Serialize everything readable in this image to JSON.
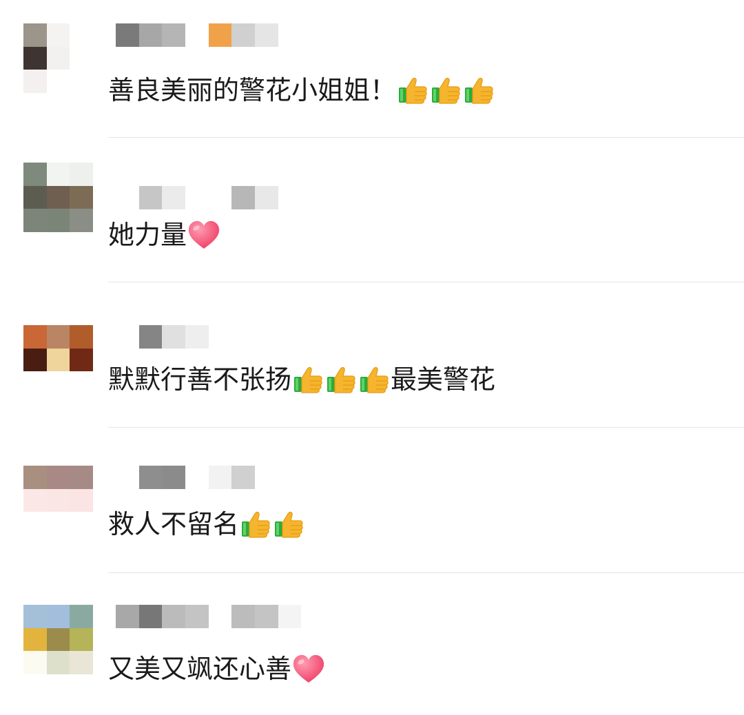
{
  "comments": [
    {
      "text_before": "善良美丽的警花小姐姐！",
      "thumbs": 3,
      "text_after": "",
      "heart": false,
      "avatar_pixels": [
        "#9b958a",
        "#f4f3f1",
        "#ffffff",
        "#3e3431",
        "#f2f1f0",
        "#ffffff",
        "#f5f0f0",
        "#ffffff",
        "#ffffff"
      ],
      "name_pixels": [
        "#7a7a7a",
        "#a7a7a7",
        "#b5b5b5",
        "gap",
        "#f0a24a",
        "#d0d0d0",
        "#e5e5e5"
      ]
    },
    {
      "text_before": "她力量",
      "thumbs": 0,
      "text_after": "",
      "heart": true,
      "avatar_pixels": [
        "#7e8a7c",
        "#f2f4f2",
        "#edf0ed",
        "#5c5d50",
        "#6f5f50",
        "#7c6c55",
        "#7d857b",
        "#7a8577",
        "#8a8e86"
      ],
      "name_pixels": [
        "#ffffff",
        "#c6c6c6",
        "#ebebeb",
        "#ffffff",
        "gap",
        "#b7b7b7",
        "#e8e8e8"
      ]
    },
    {
      "text_before": "默默行善不张扬",
      "thumbs": 3,
      "text_after": "最美警花",
      "heart": false,
      "avatar_pixels": [
        "#c96736",
        "#b98564",
        "#b05c2b",
        "#4a1d12",
        "#efd49c",
        "#6f2915",
        "#ffffff",
        "#ffffff",
        "#ffffff"
      ],
      "name_pixels": [
        "#ffffff",
        "#858585",
        "#e0e0e0",
        "#eeeeee"
      ]
    },
    {
      "text_before": "救人不留名",
      "thumbs": 2,
      "text_after": "",
      "heart": false,
      "avatar_pixels": [
        "#a88f80",
        "#a88985",
        "#a68a86",
        "#fbe8e6",
        "#fae6e4",
        "#fae4e4",
        "#ffffff",
        "#ffffff",
        "#ffffff"
      ],
      "name_pixels": [
        "#ffffff",
        "#8e8e8e",
        "#8b8b8b",
        "#ffffff",
        "#f2f2f2",
        "#d0d0d0"
      ]
    },
    {
      "text_before": "又美又飒还心善",
      "thumbs": 0,
      "text_after": "",
      "heart": true,
      "avatar_pixels": [
        "#a4bfd8",
        "#a2bedc",
        "#8aa9a1",
        "#e2b43d",
        "#9b8c4b",
        "#b5b458",
        "#fbfbf2",
        "#dde1cb",
        "#e9e5d7"
      ],
      "name_pixels": [
        "#a8a8a8",
        "#777777",
        "#bbbbbb",
        "#c4c4c4",
        "gap",
        "#bcbcbc",
        "#c4c4c4",
        "#f4f4f4"
      ]
    }
  ]
}
